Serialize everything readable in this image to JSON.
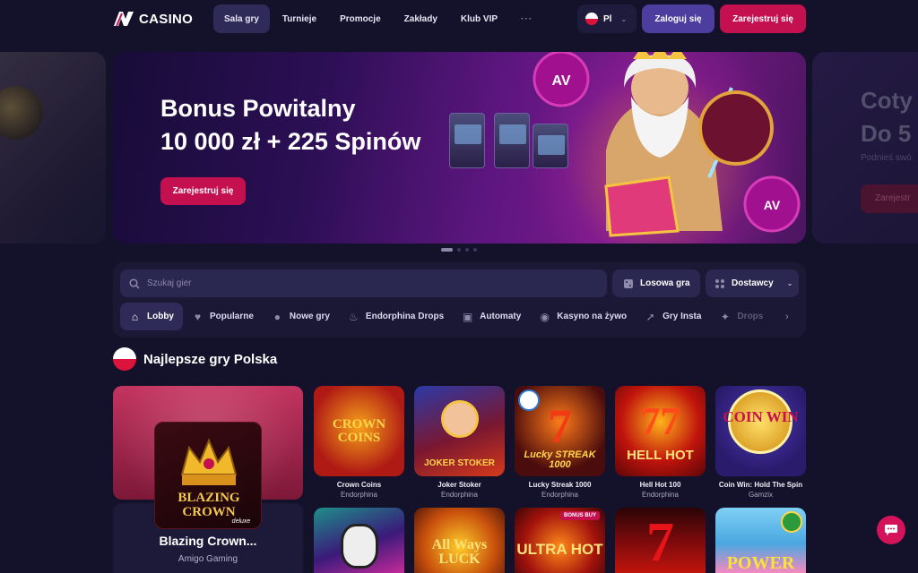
{
  "brand": {
    "name": "CASINO"
  },
  "nav": {
    "items": [
      {
        "label": "Sala gry",
        "active": true
      },
      {
        "label": "Turnieje"
      },
      {
        "label": "Promocje"
      },
      {
        "label": "Zakłady"
      },
      {
        "label": "Klub VIP"
      }
    ],
    "more": "···"
  },
  "header": {
    "language": "Pl",
    "login_label": "Zaloguj się",
    "register_label": "Zarejestruj się"
  },
  "hero": {
    "title_line1": "Bonus Powitalny",
    "title_line2": "10 000 zł + 225 Spinów",
    "cta_label": "Zarejestruj się",
    "active_slide": 1,
    "slide_count": 4
  },
  "next_promo": {
    "title_line1": "Coty",
    "title_line2": "Do 5",
    "subtitle": "Podnieś swó",
    "cta_label": "Zarejestr"
  },
  "filters": {
    "search_placeholder": "Szukaj gier",
    "random_label": "Losowa gra",
    "providers_label": "Dostawcy",
    "categories": [
      {
        "label": "Lobby",
        "icon": "home-icon",
        "active": true
      },
      {
        "label": "Popularne",
        "icon": "heart-icon"
      },
      {
        "label": "Nowe gry",
        "icon": "new-badge-icon"
      },
      {
        "label": "Endorphina Drops",
        "icon": "flame-icon"
      },
      {
        "label": "Automaty",
        "icon": "slot-machine-icon"
      },
      {
        "label": "Kasyno na żywo",
        "icon": "live-icon"
      },
      {
        "label": "Gry Insta",
        "icon": "rocket-icon"
      },
      {
        "label": "Drops",
        "icon": "drops-icon"
      }
    ]
  },
  "section": {
    "title": "Najlepsze gry Polska"
  },
  "featured_game": {
    "name": "Blazing Crown...",
    "provider": "Amigo Gaming",
    "art_line1": "BLAZING",
    "art_line2": "CROWN",
    "art_sub": "deluxe"
  },
  "games_row1": [
    {
      "name": "Crown Coins",
      "provider": "Endorphina",
      "art": "CROWN COINS",
      "bg": "#b01a14"
    },
    {
      "name": "Joker Stoker",
      "provider": "Endorphina",
      "art": "JOKER STOKER",
      "bg": "#7a1730"
    },
    {
      "name": "Lucky Streak 1000",
      "provider": "Endorphina",
      "art": "Lucky STREAK 1000",
      "bg": "#4a0c0c"
    },
    {
      "name": "Hell Hot 100",
      "provider": "Endorphina",
      "art": "HELL HOT",
      "bg": "#8a0c10"
    },
    {
      "name": "Coin Win: Hold The Spin",
      "provider": "Gamzix",
      "art": "COIN WIN",
      "bg": "#2b1b6d"
    }
  ],
  "games_row2": [
    {
      "art": "",
      "bg": "#3a1a7a",
      "badge": ""
    },
    {
      "art": "All Ways LUCK",
      "bg": "#c8500c",
      "badge": ""
    },
    {
      "art": "ULTRA HOT",
      "bg": "#a3120c",
      "badge": "BONUS BUY"
    },
    {
      "art": "7",
      "bg": "#7a0a0c",
      "badge": ""
    },
    {
      "art": "POWER",
      "bg": "#4aa7e0",
      "badge": ""
    }
  ],
  "colors": {
    "accent": "#c5104f",
    "primary": "#4c3d9e",
    "background": "#14122b"
  }
}
